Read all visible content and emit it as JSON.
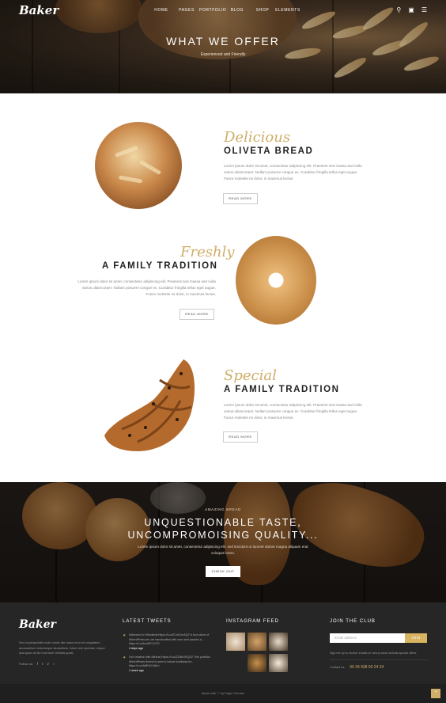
{
  "header": {
    "logo": "Baker",
    "nav": [
      "HOME",
      "PAGES",
      "PORTFOLIO",
      "BLOG",
      "SHOP",
      "ELEMENTS"
    ],
    "icons": [
      "search-icon",
      "cart-icon",
      "menu-icon"
    ],
    "cart_count": "0"
  },
  "hero": {
    "title": "WHAT WE OFFER",
    "subtitle": "Experienced and Friendly"
  },
  "products": [
    {
      "script": "Delicious",
      "title": "OLIVETA BREAD",
      "text": "Lorem ipsum dolor sit amet, consectetur adipiscing elit. Praesent sed massa sed nulla varius ullamcorper. Nullam posuere congue ex. Curabitur fringilla tellus eget augue. Fusce molestie mi dolor, in maximus lectus.",
      "button": "READ MORE"
    },
    {
      "script": "Freshly",
      "title": "A FAMILY TRADITION",
      "text": "Lorem ipsum dolor sit amet, consectetur adipiscing elit. Praesent sed massa sed nulla varius ullamcorper. Nullam posuere congue ex. Curabitur fringilla tellus eget augue. Fusce molestie mi dolor, in maximus lectus.",
      "button": "READ MORE"
    },
    {
      "script": "Special",
      "title": "A FAMILY TRADITION",
      "text": "Lorem ipsum dolor sit amet, consectetur adipiscing elit. Praesent sed massa sed nulla varius ullamcorper. Nullam posuere congue ex. Curabitur fringilla tellus eget augue. Fusce molestie mi dolor, in maximus lectus.",
      "button": "READ MORE"
    }
  ],
  "banner": {
    "kicker": "AMAZING BREAD",
    "title_line1": "UNQUESTIONABLE TASTE,",
    "title_line2": "UNCOMPROMOISING QUALITY...",
    "text": "Lorem ipsum dolor sit amet, consectetur adipiscing elit, sed tincidunt ut laoreet dolore magna aliquam erat volutpat lorem.",
    "button": "CHECK OUT"
  },
  "footer": {
    "logo": "Baker",
    "about": "Sed ut perspiciatis unde omnis iste natus error sit voluptatem accusantium doloremque laudantium, totam rem aperiam, eaque ipsa quae ab illo inventore veritatis quasi.",
    "follow_label": "Follow us:",
    "social_icons": [
      "facebook-icon",
      "twitter-icon",
      "vine-icon",
      "dribbble-icon"
    ],
    "tweets_heading": "LATEST TWEETS",
    "tweets": [
      {
        "text": "Welcome to Hilindsmit https://t.co/EJuKJmAQY A true piece of #WordPress art; we handcrafted with care and packed a ... https://t.co/bvidEC417D",
        "ago": "4 days ago"
      },
      {
        "text": "Get creative with Mintuel https://t.co/ZZ8eGRQ2V This portfolio #WordPress theme is sure to infuse liveliness int... https://t.co/htfEfe7oDen",
        "ago": "1 week ago"
      }
    ],
    "instagram_heading": "INSTAGRAM FEED",
    "instagram_photos": 6,
    "club_heading": "JOIN THE CLUB",
    "email_placeholder": "Email address",
    "join_button": "JOIN",
    "club_note": "Sign me up to receive emails on new product arrivals special offers.",
    "contact_label": "Contact us:",
    "phone": "00 34 938 60 24 24",
    "copyright_pre": "Made with",
    "copyright_post": "by Edge Themes"
  },
  "colors": {
    "accent": "#cfae6a",
    "footer_bg": "#262626",
    "title_text": "#222222"
  }
}
